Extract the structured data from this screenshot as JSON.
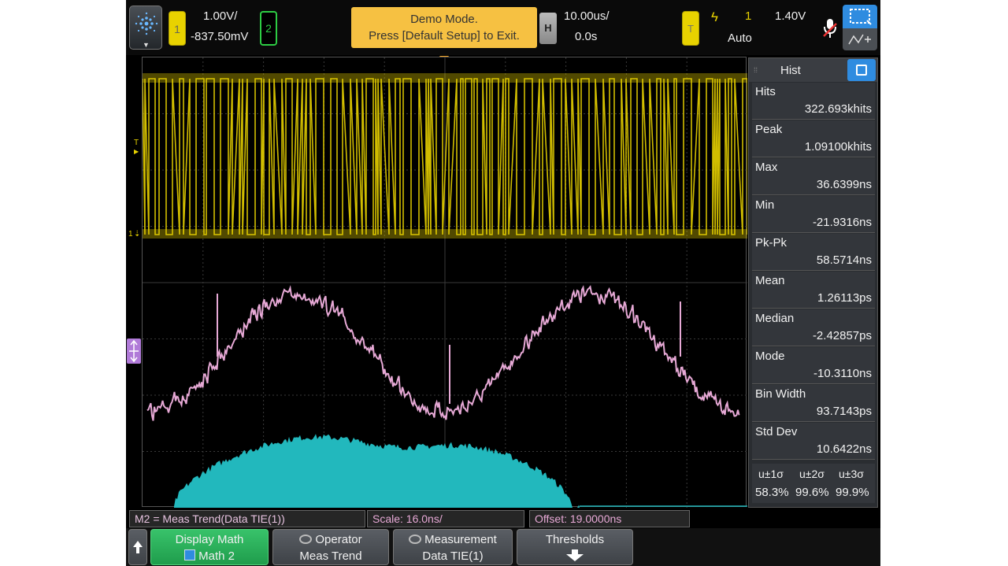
{
  "top": {
    "ch1_badge": "1",
    "ch1_scale": "1.00V/",
    "ch1_offset": "-837.50mV",
    "ch2_badge": "2",
    "demo_line1": "Demo Mode.",
    "demo_line2": "Press [Default Setup] to Exit.",
    "h_badge": "H",
    "time_scale": "10.00us/",
    "time_delay": "0.0s",
    "trig_badge": "T",
    "trig_source": "1",
    "trig_level": "1.40V",
    "trig_mode": "Auto"
  },
  "markers": {
    "trig_level_marker": "T",
    "ch1_marker": "1"
  },
  "panel": {
    "title": "Hist",
    "stats": [
      {
        "label": "Hits",
        "value": "322.693khits"
      },
      {
        "label": "Peak",
        "value": "1.09100khits"
      },
      {
        "label": "Max",
        "value": "36.6399ns"
      },
      {
        "label": "Min",
        "value": "-21.9316ns"
      },
      {
        "label": "Pk-Pk",
        "value": "58.5714ns"
      },
      {
        "label": "Mean",
        "value": "1.26113ps"
      },
      {
        "label": "Median",
        "value": "-2.42857ps"
      },
      {
        "label": "Mode",
        "value": "-10.3110ns"
      },
      {
        "label": "Bin Width",
        "value": "93.7143ps"
      },
      {
        "label": "Std Dev",
        "value": "10.6422ns"
      }
    ],
    "sigma_headers": [
      "u±1σ",
      "u±2σ",
      "u±3σ"
    ],
    "sigma_values": [
      "58.3%",
      "99.6%",
      "99.9%"
    ]
  },
  "bottom": {
    "math_def": "M2 = Meas Trend(Data TIE(1))",
    "scale": "Scale: 16.0ns/",
    "offset": "Offset: 19.0000ns"
  },
  "softkeys": {
    "display_math": "Display Math",
    "math2": "Math 2",
    "operator": "Operator",
    "operator_value": "Meas Trend",
    "measurement": "Measurement",
    "measurement_value": "Data TIE(1)",
    "thresholds": "Thresholds"
  },
  "colors": {
    "channel1": "#e8d200",
    "channel2": "#2dcc44",
    "math_trend": "#e7a9d6",
    "histogram": "#22b8bd",
    "demo_banner": "#f6c142",
    "accent_blue": "#2f8ce0",
    "softkey_green": "#2bb05a"
  }
}
